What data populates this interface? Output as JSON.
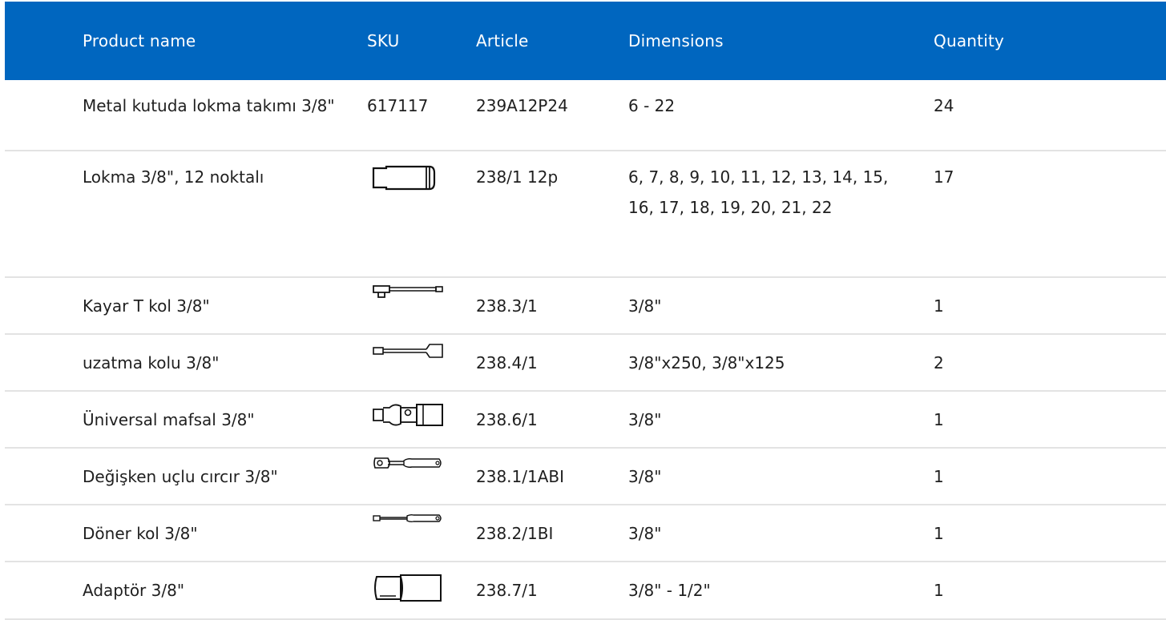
{
  "columns": {
    "name": "Product name",
    "sku": "SKU",
    "article": "Article",
    "dimensions": "Dimensions",
    "quantity": "Quantity"
  },
  "rows": [
    {
      "name": "Metal kutuda lokma takımı 3/8\"",
      "sku": "617117",
      "article": "239A12P24",
      "dimensions": "6 - 22",
      "quantity": "24"
    },
    {
      "name": "Lokma 3/8\", 12 noktalı",
      "sku_icon": "socket-icon",
      "article": "238/1 12p",
      "dimensions": "6, 7, 8, 9, 10, 11, 12, 13, 14, 15, 16, 17, 18, 19, 20, 21, 22",
      "quantity": "17"
    },
    {
      "name": "Kayar T kol 3/8\"",
      "sku_icon": "sliding-t-handle-icon",
      "article": "238.3/1",
      "dimensions": "3/8\"",
      "quantity": "1"
    },
    {
      "name": "uzatma kolu 3/8\"",
      "sku_icon": "extension-bar-icon",
      "article": "238.4/1",
      "dimensions": "3/8\"x250, 3/8\"x125",
      "quantity": "2"
    },
    {
      "name": "Üniversal mafsal 3/8\"",
      "sku_icon": "universal-joint-icon",
      "article": "238.6/1",
      "dimensions": "3/8\"",
      "quantity": "1"
    },
    {
      "name": "Değişken uçlu cırcır 3/8\"",
      "sku_icon": "ratchet-icon",
      "article": "238.1/1ABI",
      "dimensions": "3/8\"",
      "quantity": "1"
    },
    {
      "name": "Döner kol 3/8\"",
      "sku_icon": "spinner-handle-icon",
      "article": "238.2/1BI",
      "dimensions": "3/8\"",
      "quantity": "1"
    },
    {
      "name": "Adaptör 3/8\"",
      "sku_icon": "adapter-icon",
      "article": "238.7/1",
      "dimensions": "3/8\" - 1/2\"",
      "quantity": "1"
    }
  ],
  "colors": {
    "header_bg": "#0066bf",
    "divider": "#e3e3e3"
  }
}
